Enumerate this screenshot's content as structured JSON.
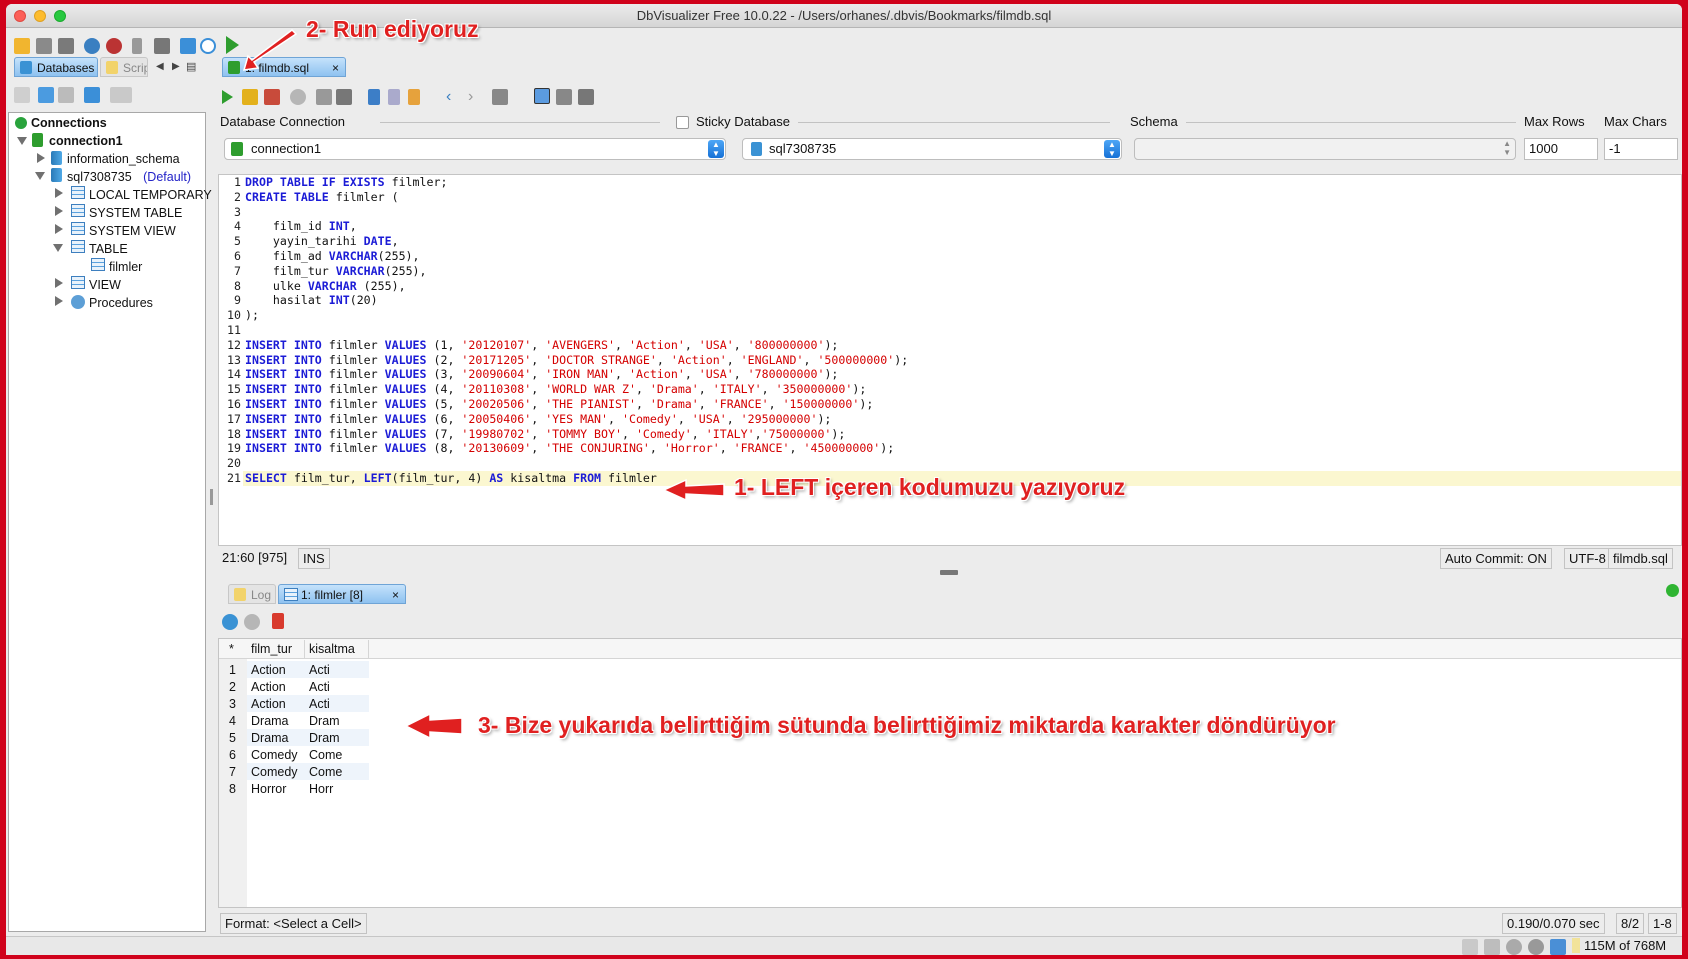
{
  "window": {
    "title": "DbVisualizer Free 10.0.22 - /Users/orhanes/.dbvis/Bookmarks/filmdb.sql"
  },
  "left_tabs": {
    "databases": "Databases",
    "scripts": "Scrip"
  },
  "tree": {
    "root": "Connections",
    "connection": "connection1",
    "schema1": "information_schema",
    "schema2": "sql7308735",
    "schema2_default": "(Default)",
    "nodes": [
      "LOCAL TEMPORARY",
      "SYSTEM TABLE",
      "SYSTEM VIEW",
      "TABLE",
      "filmler",
      "VIEW",
      "Procedures"
    ]
  },
  "editor_tab": {
    "label": "1: filmdb.sql",
    "close": "×"
  },
  "connection_bar": {
    "db_connection_label": "Database Connection",
    "db_connection_value": "connection1",
    "sticky_label": "Sticky Database",
    "database_value": "sql7308735",
    "schema_label": "Schema",
    "schema_value": "",
    "max_rows_label": "Max Rows",
    "max_rows_value": "1000",
    "max_chars_label": "Max Chars",
    "max_chars_value": "-1"
  },
  "editor_lines": [
    [
      {
        "t": "DROP TABLE IF EXISTS",
        "k": "kw"
      },
      {
        "t": " filmler;"
      }
    ],
    [
      {
        "t": "CREATE TABLE",
        "k": "kw"
      },
      {
        "t": " filmler ("
      }
    ],
    [],
    [
      {
        "t": "    film_id "
      },
      {
        "t": "INT",
        "k": "kw"
      },
      {
        "t": ","
      }
    ],
    [
      {
        "t": "    yayin_tarihi "
      },
      {
        "t": "DATE",
        "k": "kw"
      },
      {
        "t": ","
      }
    ],
    [
      {
        "t": "    film_ad "
      },
      {
        "t": "VARCHAR",
        "k": "kw"
      },
      {
        "t": "(255),"
      }
    ],
    [
      {
        "t": "    film_tur "
      },
      {
        "t": "VARCHAR",
        "k": "kw"
      },
      {
        "t": "(255),"
      }
    ],
    [
      {
        "t": "    ulke "
      },
      {
        "t": "VARCHAR",
        "k": "kw"
      },
      {
        "t": " (255),"
      }
    ],
    [
      {
        "t": "    hasilat "
      },
      {
        "t": "INT",
        "k": "kw"
      },
      {
        "t": "(20)"
      }
    ],
    [
      {
        "t": ");"
      }
    ],
    [],
    [
      {
        "t": "INSERT INTO",
        "k": "kw"
      },
      {
        "t": " filmler "
      },
      {
        "t": "VALUES",
        "k": "kw"
      },
      {
        "t": " (1, "
      },
      {
        "t": "'20120107'",
        "k": "str"
      },
      {
        "t": ", "
      },
      {
        "t": "'AVENGERS'",
        "k": "str"
      },
      {
        "t": ", "
      },
      {
        "t": "'Action'",
        "k": "str"
      },
      {
        "t": ", "
      },
      {
        "t": "'USA'",
        "k": "str"
      },
      {
        "t": ", "
      },
      {
        "t": "'800000000'",
        "k": "str"
      },
      {
        "t": ");"
      }
    ],
    [
      {
        "t": "INSERT INTO",
        "k": "kw"
      },
      {
        "t": " filmler "
      },
      {
        "t": "VALUES",
        "k": "kw"
      },
      {
        "t": " (2, "
      },
      {
        "t": "'20171205'",
        "k": "str"
      },
      {
        "t": ", "
      },
      {
        "t": "'DOCTOR STRANGE'",
        "k": "str"
      },
      {
        "t": ", "
      },
      {
        "t": "'Action'",
        "k": "str"
      },
      {
        "t": ", "
      },
      {
        "t": "'ENGLAND'",
        "k": "str"
      },
      {
        "t": ", "
      },
      {
        "t": "'500000000'",
        "k": "str"
      },
      {
        "t": ");"
      }
    ],
    [
      {
        "t": "INSERT INTO",
        "k": "kw"
      },
      {
        "t": " filmler "
      },
      {
        "t": "VALUES",
        "k": "kw"
      },
      {
        "t": " (3, "
      },
      {
        "t": "'20090604'",
        "k": "str"
      },
      {
        "t": ", "
      },
      {
        "t": "'IRON MAN'",
        "k": "str"
      },
      {
        "t": ", "
      },
      {
        "t": "'Action'",
        "k": "str"
      },
      {
        "t": ", "
      },
      {
        "t": "'USA'",
        "k": "str"
      },
      {
        "t": ", "
      },
      {
        "t": "'780000000'",
        "k": "str"
      },
      {
        "t": ");"
      }
    ],
    [
      {
        "t": "INSERT INTO",
        "k": "kw"
      },
      {
        "t": " filmler "
      },
      {
        "t": "VALUES",
        "k": "kw"
      },
      {
        "t": " (4, "
      },
      {
        "t": "'20110308'",
        "k": "str"
      },
      {
        "t": ", "
      },
      {
        "t": "'WORLD WAR Z'",
        "k": "str"
      },
      {
        "t": ", "
      },
      {
        "t": "'Drama'",
        "k": "str"
      },
      {
        "t": ", "
      },
      {
        "t": "'ITALY'",
        "k": "str"
      },
      {
        "t": ", "
      },
      {
        "t": "'350000000'",
        "k": "str"
      },
      {
        "t": ");"
      }
    ],
    [
      {
        "t": "INSERT INTO",
        "k": "kw"
      },
      {
        "t": " filmler "
      },
      {
        "t": "VALUES",
        "k": "kw"
      },
      {
        "t": " (5, "
      },
      {
        "t": "'20020506'",
        "k": "str"
      },
      {
        "t": ", "
      },
      {
        "t": "'THE PIANIST'",
        "k": "str"
      },
      {
        "t": ", "
      },
      {
        "t": "'Drama'",
        "k": "str"
      },
      {
        "t": ", "
      },
      {
        "t": "'FRANCE'",
        "k": "str"
      },
      {
        "t": ", "
      },
      {
        "t": "'150000000'",
        "k": "str"
      },
      {
        "t": ");"
      }
    ],
    [
      {
        "t": "INSERT INTO",
        "k": "kw"
      },
      {
        "t": " filmler "
      },
      {
        "t": "VALUES",
        "k": "kw"
      },
      {
        "t": " (6, "
      },
      {
        "t": "'20050406'",
        "k": "str"
      },
      {
        "t": ", "
      },
      {
        "t": "'YES MAN'",
        "k": "str"
      },
      {
        "t": ", "
      },
      {
        "t": "'Comedy'",
        "k": "str"
      },
      {
        "t": ", "
      },
      {
        "t": "'USA'",
        "k": "str"
      },
      {
        "t": ", "
      },
      {
        "t": "'295000000'",
        "k": "str"
      },
      {
        "t": ");"
      }
    ],
    [
      {
        "t": "INSERT INTO",
        "k": "kw"
      },
      {
        "t": " filmler "
      },
      {
        "t": "VALUES",
        "k": "kw"
      },
      {
        "t": " (7, "
      },
      {
        "t": "'19980702'",
        "k": "str"
      },
      {
        "t": ", "
      },
      {
        "t": "'TOMMY BOY'",
        "k": "str"
      },
      {
        "t": ", "
      },
      {
        "t": "'Comedy'",
        "k": "str"
      },
      {
        "t": ", "
      },
      {
        "t": "'ITALY'",
        "k": "str"
      },
      {
        "t": ","
      },
      {
        "t": "'75000000'",
        "k": "str"
      },
      {
        "t": ");"
      }
    ],
    [
      {
        "t": "INSERT INTO",
        "k": "kw"
      },
      {
        "t": " filmler "
      },
      {
        "t": "VALUES",
        "k": "kw"
      },
      {
        "t": " (8, "
      },
      {
        "t": "'20130609'",
        "k": "str"
      },
      {
        "t": ", "
      },
      {
        "t": "'THE CONJURING'",
        "k": "str"
      },
      {
        "t": ", "
      },
      {
        "t": "'Horror'",
        "k": "str"
      },
      {
        "t": ", "
      },
      {
        "t": "'FRANCE'",
        "k": "str"
      },
      {
        "t": ", "
      },
      {
        "t": "'450000000'",
        "k": "str"
      },
      {
        "t": ");"
      }
    ],
    [],
    [
      {
        "t": "SELECT",
        "k": "kw"
      },
      {
        "t": " film_tur, "
      },
      {
        "t": "LEFT",
        "k": "kw"
      },
      {
        "t": "(film_tur, 4) "
      },
      {
        "t": "AS",
        "k": "kw"
      },
      {
        "t": " kisaltma "
      },
      {
        "t": "FROM",
        "k": "kw"
      },
      {
        "t": " filmler"
      }
    ]
  ],
  "editor_status": {
    "position": "21:60 [975]",
    "mode": "INS",
    "auto_commit": "Auto Commit: ON",
    "encoding": "UTF-8",
    "file": "filmdb.sql"
  },
  "result_tabs": {
    "log": "Log",
    "result": "1: filmler [8]",
    "close": "×"
  },
  "grid": {
    "corner": "*",
    "columns": [
      "film_tur",
      "kisaltma"
    ],
    "rows": [
      [
        "1",
        "Action",
        "Acti"
      ],
      [
        "2",
        "Action",
        "Acti"
      ],
      [
        "3",
        "Action",
        "Acti"
      ],
      [
        "4",
        "Drama",
        "Dram"
      ],
      [
        "5",
        "Drama",
        "Dram"
      ],
      [
        "6",
        "Comedy",
        "Come"
      ],
      [
        "7",
        "Comedy",
        "Come"
      ],
      [
        "8",
        "Horror",
        "Horr"
      ]
    ]
  },
  "result_status": {
    "format": "Format: <Select a Cell>",
    "timing": "0.190/0.070 sec",
    "dims": "8/2",
    "range": "1-8"
  },
  "bottom_status": {
    "memory": "115M of 768M"
  },
  "annotations": {
    "a1": "1- LEFT içeren kodumuzu yazıyoruz",
    "a2": "2- Run ediyoruz",
    "a3": "3- Bize yukarıda belirttiğim sütunda belirttiğimiz miktarda karakter döndürüyor"
  },
  "colors": {
    "accent_red": "#e02020",
    "keyword": "#1b1bd6",
    "string": "#d40000",
    "run_green": "#2e9d2e"
  }
}
